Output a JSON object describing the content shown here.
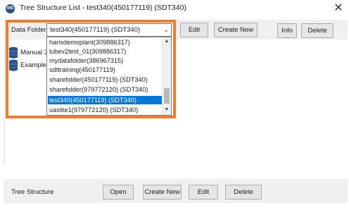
{
  "window": {
    "app_icon": "MS",
    "title": "Tree Structure List - test340(450177119) (SDT340)",
    "close_glyph": "✕"
  },
  "top_toolbar": {
    "data_folder_label": "Data Folder",
    "data_folder_value": "test340(450177119) (SDT340)",
    "edit_label": "Edit",
    "create_new_label": "Create New",
    "info_label": "Info",
    "delete_label": "Delete"
  },
  "tree": {
    "items": [
      {
        "label": "Manual 3-",
        "icon": "database-icon"
      },
      {
        "label": "Example p",
        "icon": "database-icon"
      }
    ]
  },
  "data_folder_dropdown": {
    "options": [
      "harisdemoplant(309886317)",
      "lubev2test_01(309886317)",
      "mydatafolder(386967315)",
      "sdttraining(450177119)",
      "sharefolder(450177119) (SDT340)",
      "sharefolder(979772120) (SDT340)",
      "test340(450177119) (SDT340)",
      "uaslite1(979772120) (SDT340)"
    ],
    "selected_index": 6
  },
  "bottom_toolbar": {
    "section_label": "Tree Structure",
    "open_label": "Open",
    "create_new_label": "Create New",
    "edit_label": "Edit",
    "delete_label": "Delete"
  },
  "colors": {
    "highlight": "#ed7d31",
    "selection": "#0078d7",
    "panel_bg": "#f0f0f0"
  }
}
